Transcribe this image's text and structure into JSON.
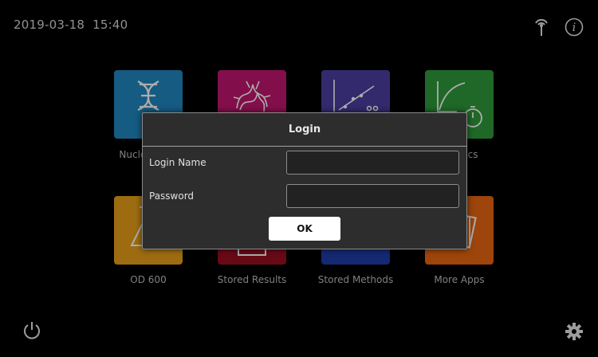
{
  "status_bar": {
    "datetime": "2019-03-18  15:40",
    "wifi_icon": "wireless-antenna-icon",
    "info_icon": "info-icon"
  },
  "apps": [
    {
      "label": "Nucleic Acid",
      "icon": "dna-icon",
      "color": "#1f86c0"
    },
    {
      "label": "",
      "icon": "protein-icon",
      "color": "#c0176f"
    },
    {
      "label": "",
      "icon": "scatter-plot-icon",
      "color": "#4b3ea0"
    },
    {
      "label": "Kinetics",
      "icon": "kinetics-stopwatch-icon",
      "color": "#2f9a3a"
    },
    {
      "label": "OD 600",
      "icon": "flask-icon",
      "color": "#e8a01a"
    },
    {
      "label": "Stored Results",
      "icon": "stored-results-icon",
      "color": "#9a0f1f"
    },
    {
      "label": "Stored Methods",
      "icon": "stored-methods-icon",
      "color": "#1e3da8"
    },
    {
      "label": "More Apps",
      "icon": "more-apps-icon",
      "color": "#e8660f"
    }
  ],
  "footer": {
    "power_icon": "power-icon",
    "settings_icon": "gear-icon"
  },
  "login_dialog": {
    "title": "Login",
    "login_name_label": "Login Name",
    "login_name_value": "",
    "password_label": "Password",
    "password_value": "",
    "ok_label": "OK"
  }
}
